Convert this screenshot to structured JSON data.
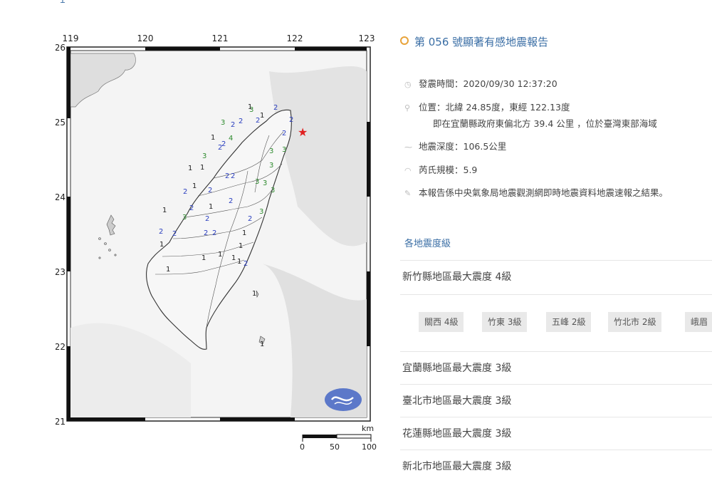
{
  "top_link": "Ｉ",
  "report": {
    "title": "第 056 號顯著有感地震報告",
    "time": "發震時間：2020/09/30 12:37:20",
    "location": "位置：北緯 24.85度，東經 122.13度",
    "location_detail": "即在宜蘭縣政府東偏北方 39.4 公里 ，位於臺灣東部海域",
    "depth": "地震深度：106.5公里",
    "magnitude": "芮氏規模：5.9",
    "note": "本報告係中央氣象局地震觀測網即時地震資料地震速報之結果。"
  },
  "intensity_section": {
    "title": "各地震度級",
    "regions": [
      "新竹縣地區最大震度 4級",
      "宜蘭縣地區最大震度 3級",
      "臺北市地區最大震度 3級",
      "花蓮縣地區最大震度 3級",
      "新北市地區最大震度 3級"
    ],
    "tags": [
      "關西 4級",
      "竹東 3級",
      "五峰 2級",
      "竹北市 2級",
      "峨眉"
    ]
  },
  "map": {
    "lon_labels": [
      "119",
      "120",
      "121",
      "122",
      "123"
    ],
    "lat_labels": [
      "26",
      "25",
      "24",
      "23",
      "22",
      "21"
    ],
    "scale_unit": "km",
    "scale_labels": [
      "0",
      "50",
      "100"
    ],
    "station_labels": {
      "level4": "4",
      "level3": "3",
      "level2": "2",
      "level1": "1"
    },
    "colors": {
      "level4": "#2e8b2e",
      "level3": "#2e8b2e",
      "level2": "#2b3fbf",
      "level1": "#222222",
      "epicenter": "#e02020"
    }
  }
}
